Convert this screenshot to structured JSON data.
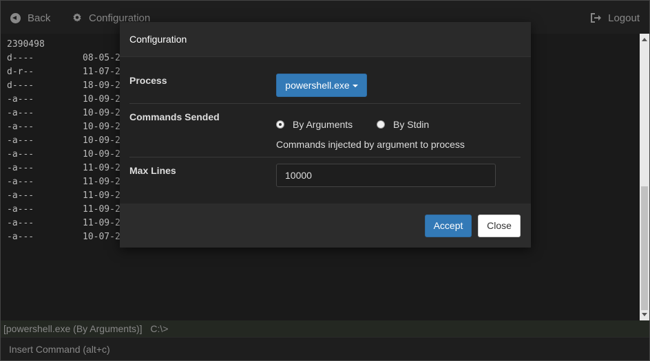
{
  "nav": {
    "back_label": "Back",
    "config_label": "Configuration",
    "logout_label": "Logout"
  },
  "terminal": {
    "first_line": "2390498",
    "rows": [
      {
        "mode": "d----",
        "date": "08-05-2"
      },
      {
        "mode": "d-r--",
        "date": "11-07-2"
      },
      {
        "mode": "d----",
        "date": "18-09-2"
      },
      {
        "mode": "-a---",
        "date": "10-09-2"
      },
      {
        "mode": "-a---",
        "date": "10-09-2"
      },
      {
        "mode": "-a---",
        "date": "10-09-2"
      },
      {
        "mode": "-a---",
        "date": "10-09-2"
      },
      {
        "mode": "-a---",
        "date": "10-09-2"
      },
      {
        "mode": "-a---",
        "date": "11-09-2"
      },
      {
        "mode": "-a---",
        "date": "11-09-2"
      },
      {
        "mode": "-a---",
        "date": "11-09-2"
      },
      {
        "mode": "-a---",
        "date": "11-09-2"
      },
      {
        "mode": "-a---",
        "date": "11-09-2"
      },
      {
        "mode": "-a---",
        "date": "10-07-2"
      }
    ]
  },
  "status": {
    "process_info": "[powershell.exe (By Arguments)]",
    "path": "C:\\>"
  },
  "command_input": {
    "placeholder": "Insert Command (alt+c)",
    "value": ""
  },
  "modal": {
    "title": "Configuration",
    "process": {
      "label": "Process",
      "selected": "powershell.exe"
    },
    "commands": {
      "label": "Commands Sended",
      "option_args": "By Arguments",
      "option_stdin": "By Stdin",
      "selected": "By Arguments",
      "help": "Commands injected by argument to process"
    },
    "max_lines": {
      "label": "Max Lines",
      "value": "10000"
    },
    "accept_label": "Accept",
    "close_label": "Close"
  },
  "colors": {
    "primary": "#337ab7",
    "background": "#1a1a1a",
    "modal_bg": "#222222"
  }
}
